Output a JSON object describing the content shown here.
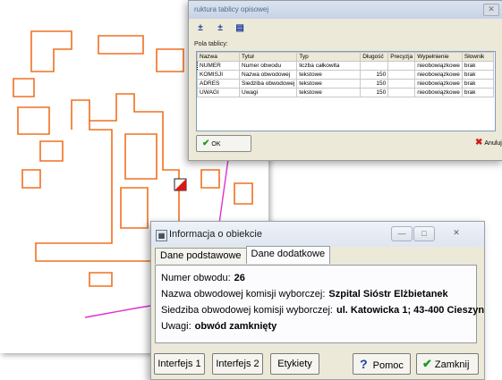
{
  "structure_window": {
    "title": "ruktura tablicy opisowej",
    "close": "✕",
    "fields_label": "Pola tablicy:",
    "columns": [
      "Nazwa",
      "Tytuł",
      "Typ",
      "Długość",
      "Precyzja",
      "Wypełnienie",
      "Słownik"
    ],
    "rows": [
      [
        "NUMER",
        "Numer obwodu",
        "liczba całkowita",
        "",
        "",
        "nieobowiązkowe",
        "brak"
      ],
      [
        "KOMISJI",
        "Nazwa obwodowej",
        "tekstowe",
        "150",
        "",
        "nieobowiązkowe",
        "brak"
      ],
      [
        "ADRES",
        "Siedziba obwodowej",
        "tekstowe",
        "150",
        "",
        "nieobowiązkowe",
        "brak"
      ],
      [
        "UWAGI",
        "Uwagi",
        "tekstowe",
        "150",
        "",
        "nieobowiązkowe",
        "brak"
      ]
    ],
    "ok_label": "OK",
    "cancel_label": "Anuluj"
  },
  "info_window": {
    "title": "Informacja o obiekcie",
    "tabs": [
      "Dane podstawowe",
      "Dane dodatkowe"
    ],
    "active_tab": "Dane dodatkowe",
    "fields": {
      "numer_label": "Numer obwodu:",
      "numer_value": "26",
      "komisja_label": "Nazwa obwodowej komisji wyborczej:",
      "komisja_value": "Szpital Sióstr Elżbietanek",
      "siedziba_label": "Siedziba obwodowej komisji wyborczej:",
      "siedziba_value": "ul. Katowicka 1; 43-400 Cieszyn",
      "uwagi_label": "Uwagi:",
      "uwagi_value": "obwód zamknięty"
    },
    "buttons": {
      "interfejs1": "Interfejs 1",
      "interfejs2": "Interfejs 2",
      "etykiety": "Etykiety",
      "pomoc": "Pomoc",
      "zamknij": "Zamknij"
    },
    "window_controls": {
      "minimize": "—",
      "maximize": "□",
      "close": "✕"
    }
  },
  "colors": {
    "building_outline": "#f07020",
    "road_line": "#e030d0",
    "selected_marker": "#d81818"
  }
}
